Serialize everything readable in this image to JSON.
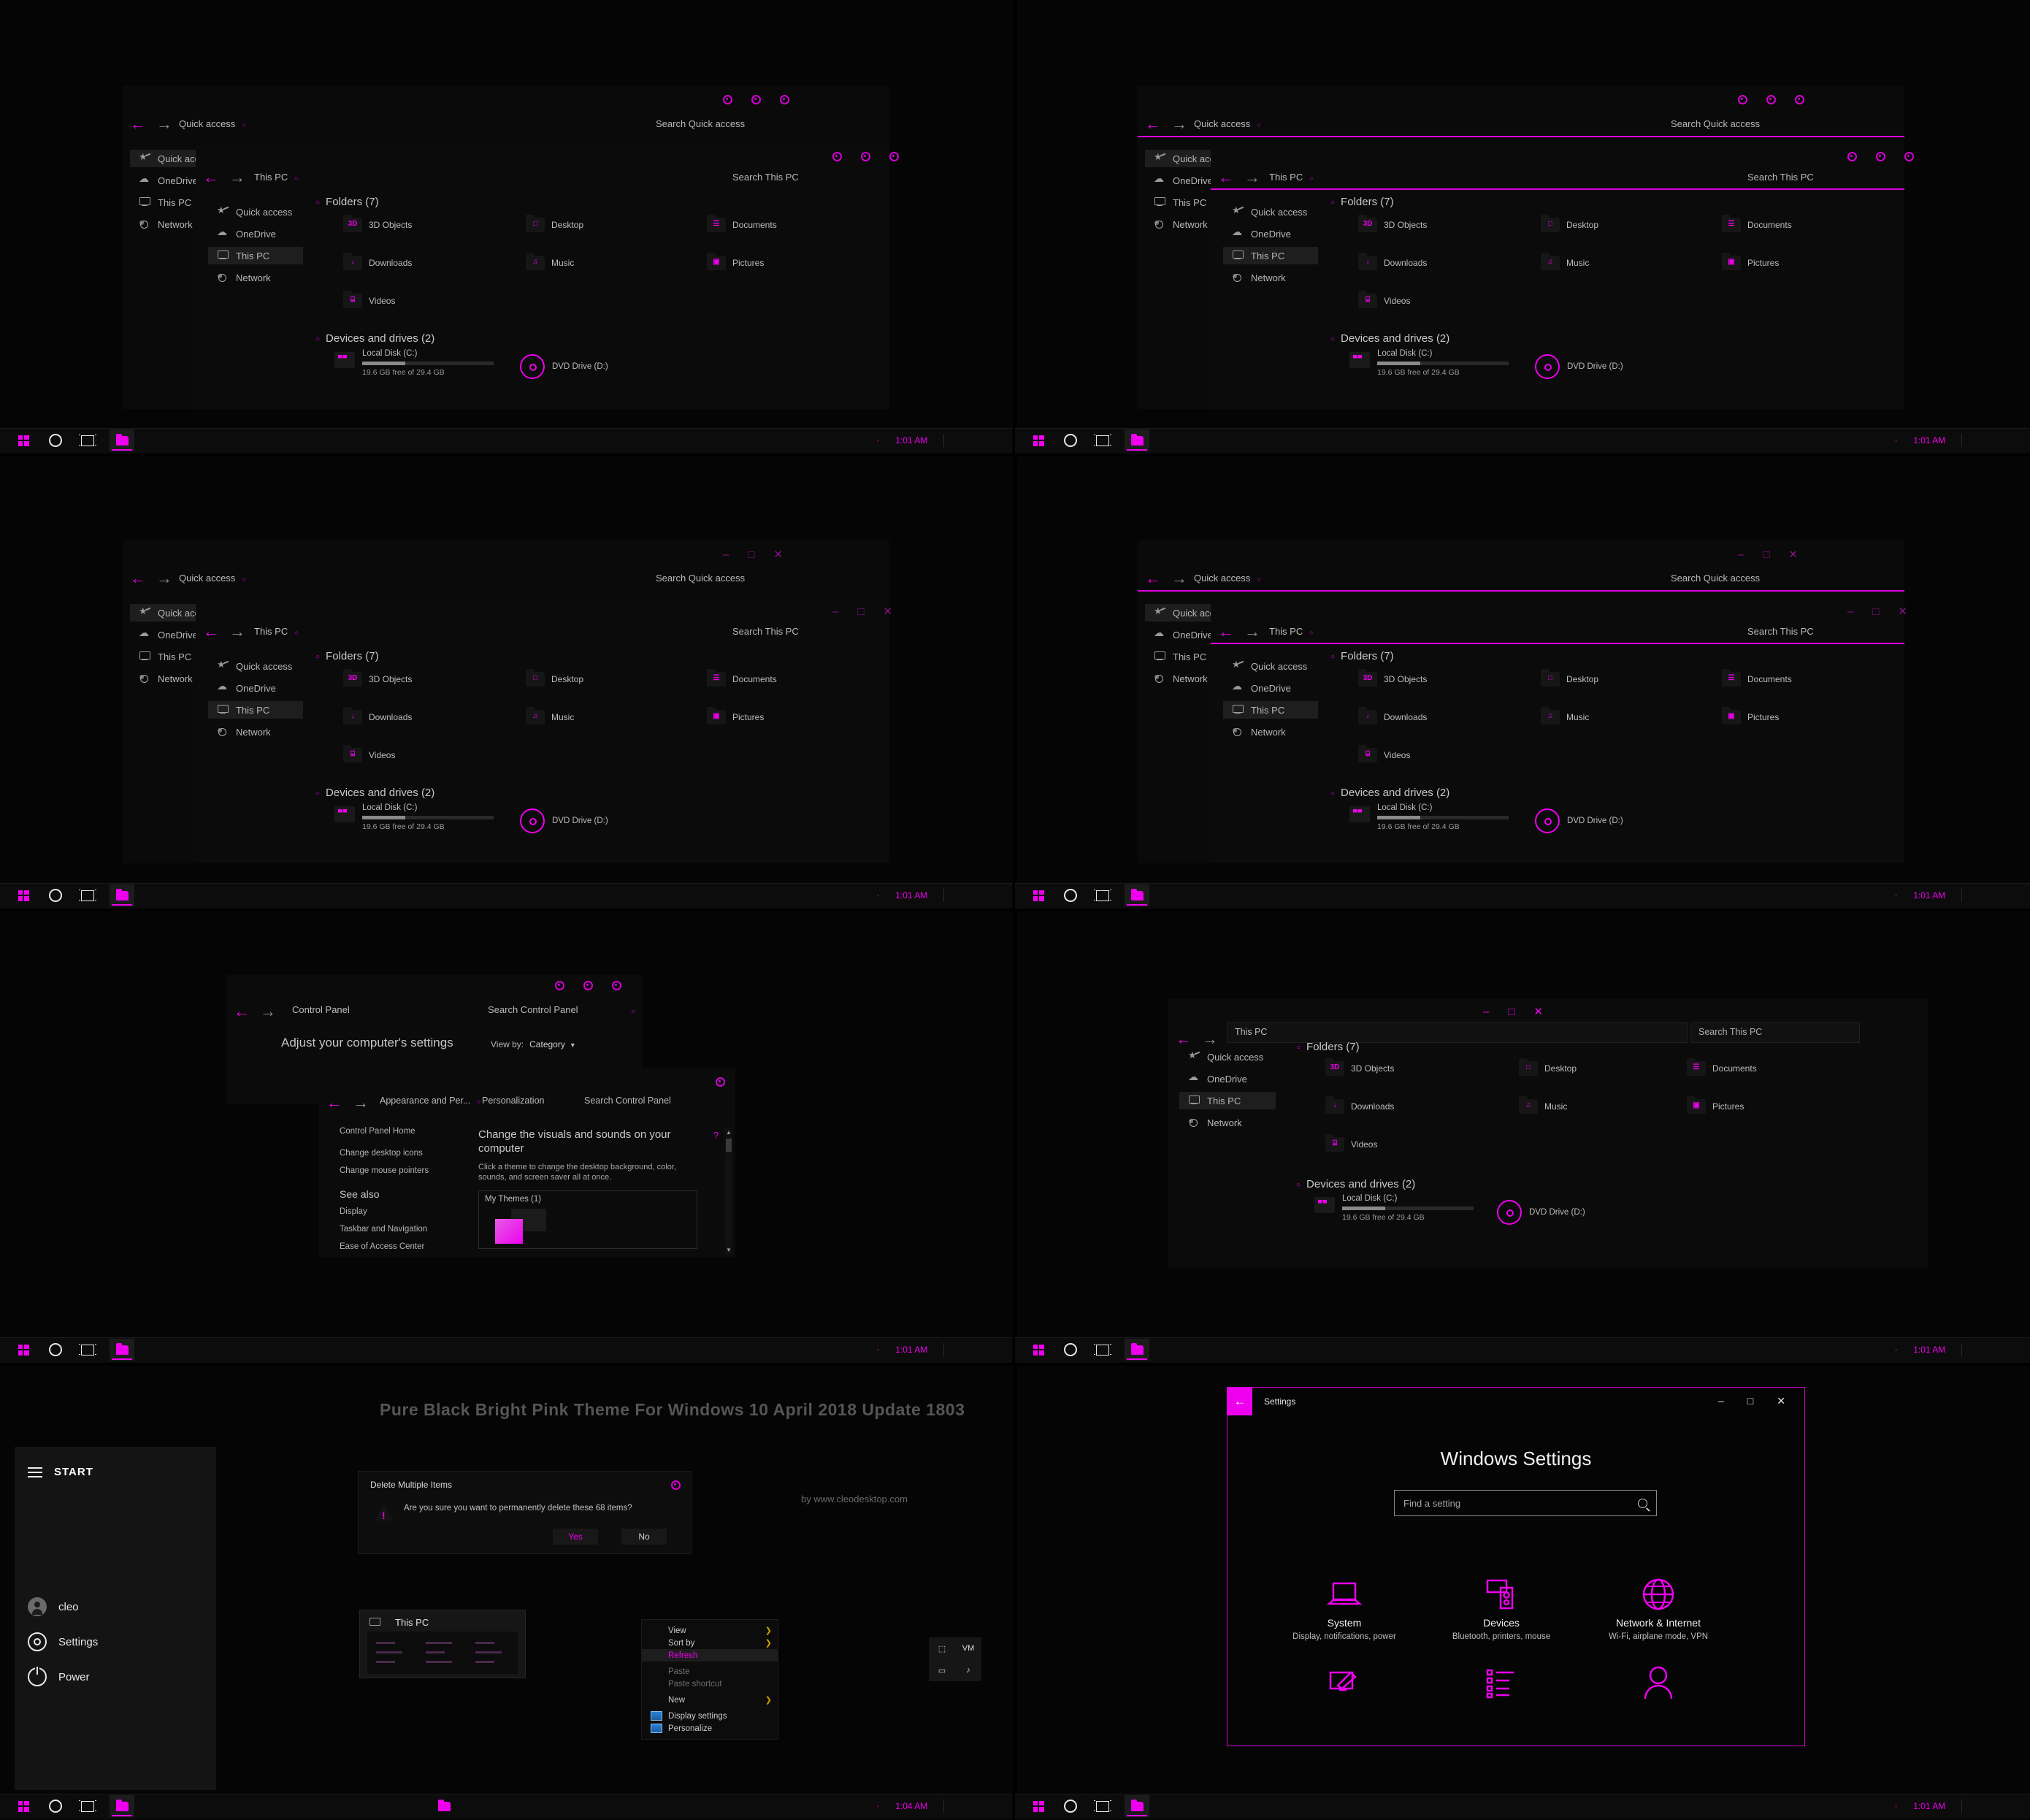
{
  "theme": {
    "name": "Pure Black Bright Pink Theme For Windows 10 April 2018 Update 1803",
    "byline": "by www.cleodesktop.com",
    "accent": "#ee00ee",
    "accent_dark": "#b100b1",
    "background": "#000000",
    "window_bg": "#0b0b0b",
    "text": "#bdbdbd"
  },
  "explorer": {
    "quick_access_window": {
      "breadcrumb": "Quick access",
      "search_placeholder": "Search Quick access",
      "nav_items": [
        {
          "label": "Quick access",
          "icon": "star-icon",
          "selected": true
        },
        {
          "label": "OneDrive",
          "icon": "cloud-icon",
          "selected": false
        },
        {
          "label": "This PC",
          "icon": "monitor-icon",
          "selected": false
        },
        {
          "label": "Network",
          "icon": "network-icon",
          "selected": false
        }
      ]
    },
    "this_pc_window": {
      "breadcrumb": "This PC",
      "search_placeholder": "Search This PC",
      "nav_items": [
        {
          "label": "Quick access",
          "icon": "star-icon",
          "selected": false
        },
        {
          "label": "OneDrive",
          "icon": "cloud-icon",
          "selected": false
        },
        {
          "label": "This PC",
          "icon": "monitor-icon",
          "selected": true
        },
        {
          "label": "Network",
          "icon": "network-icon",
          "selected": false
        }
      ],
      "groups": [
        {
          "header": "Folders (7)"
        },
        {
          "header": "Devices and drives (2)"
        }
      ],
      "folders": [
        {
          "label": "3D Objects",
          "glyph": "3D"
        },
        {
          "label": "Desktop",
          "glyph": "□"
        },
        {
          "label": "Documents",
          "glyph": "☰"
        },
        {
          "label": "Downloads",
          "glyph": "↓"
        },
        {
          "label": "Music",
          "glyph": "♫"
        },
        {
          "label": "Pictures",
          "glyph": "▣"
        },
        {
          "label": "Videos",
          "glyph": "⌸"
        }
      ],
      "drives": [
        {
          "name": "Local Disk (C:)",
          "free": "19.6 GB free of 29.4 GB",
          "used_pct": 33
        },
        {
          "name": "DVD Drive (D:)",
          "free": "",
          "used_pct": 0
        }
      ]
    },
    "window_controls": {
      "minimize": "–",
      "maximize": "□",
      "close": "✕"
    }
  },
  "control_panel": {
    "breadcrumb": "Control Panel",
    "search_placeholder": "Search Control Panel",
    "heading": "Adjust your computer's settings",
    "view_by_label": "View by:",
    "view_by_value": "Category",
    "personalization": {
      "breadcrumb_1": "Appearance and Per...",
      "breadcrumb_2": "Personalization",
      "search_placeholder": "Search Control Panel",
      "home_link": "Control Panel Home",
      "links": [
        "Change desktop icons",
        "Change mouse pointers"
      ],
      "see_also_label": "See also",
      "see_also": [
        "Display",
        "Taskbar and Navigation",
        "Ease of Access Center"
      ],
      "title": "Change the visuals and sounds on your computer",
      "description": "Click a theme to change the desktop background, color, sounds, and screen saver all at once.",
      "themes_group": "My Themes (1)",
      "help_glyph": "?"
    }
  },
  "start_menu": {
    "label": "START",
    "items": [
      {
        "label": "cleo",
        "icon": "avatar-icon"
      },
      {
        "label": "Settings",
        "icon": "gear-icon"
      },
      {
        "label": "Power",
        "icon": "power-icon"
      }
    ]
  },
  "delete_dialog": {
    "title": "Delete Multiple Items",
    "message": "Are you sure you want to permanently delete these 68 items?",
    "yes_label": "Yes",
    "no_label": "No"
  },
  "context_menu": {
    "items": [
      {
        "label": "View",
        "submenu": true,
        "state": "normal"
      },
      {
        "label": "Sort by",
        "submenu": true,
        "state": "normal"
      },
      {
        "label": "Refresh",
        "submenu": false,
        "state": "highlighted"
      },
      {
        "label": "Paste",
        "submenu": false,
        "state": "disabled"
      },
      {
        "label": "Paste shortcut",
        "submenu": false,
        "state": "disabled"
      },
      {
        "label": "New",
        "submenu": true,
        "state": "normal"
      },
      {
        "label": "Display settings",
        "submenu": false,
        "state": "normal",
        "icon": "display-icon"
      },
      {
        "label": "Personalize",
        "submenu": false,
        "state": "normal",
        "icon": "personalize-icon"
      }
    ]
  },
  "taskbar": {
    "clock": "1:01 AM",
    "clock_alt": "1:04 AM",
    "tray_glyph": "◦",
    "buttons": [
      {
        "name": "start-button",
        "icon": "windows-logo-icon"
      },
      {
        "name": "cortana-button",
        "icon": "circle-icon"
      },
      {
        "name": "task-view-button",
        "icon": "task-view-icon"
      },
      {
        "name": "file-explorer-button",
        "icon": "folder-icon",
        "active": true
      }
    ]
  },
  "taskbar_preview": {
    "title": "This PC",
    "icon": "monitor-icon"
  },
  "settings_app": {
    "title": "Settings",
    "back_glyph": "←",
    "heading": "Windows Settings",
    "search_placeholder": "Find a setting",
    "controls": {
      "minimize": "–",
      "maximize": "□",
      "close": "✕"
    },
    "tiles": [
      {
        "title": "System",
        "desc": "Display, notifications, power",
        "icon": "laptop-icon"
      },
      {
        "title": "Devices",
        "desc": "Bluetooth, printers, mouse",
        "icon": "devices-icon"
      },
      {
        "title": "Network & Internet",
        "desc": "Wi-Fi, airplane mode, VPN",
        "icon": "globe-icon"
      },
      {
        "title": "",
        "desc": "",
        "icon": "personalization-icon"
      },
      {
        "title": "",
        "desc": "",
        "icon": "apps-icon"
      },
      {
        "title": "",
        "desc": "",
        "icon": "accounts-icon"
      }
    ]
  }
}
